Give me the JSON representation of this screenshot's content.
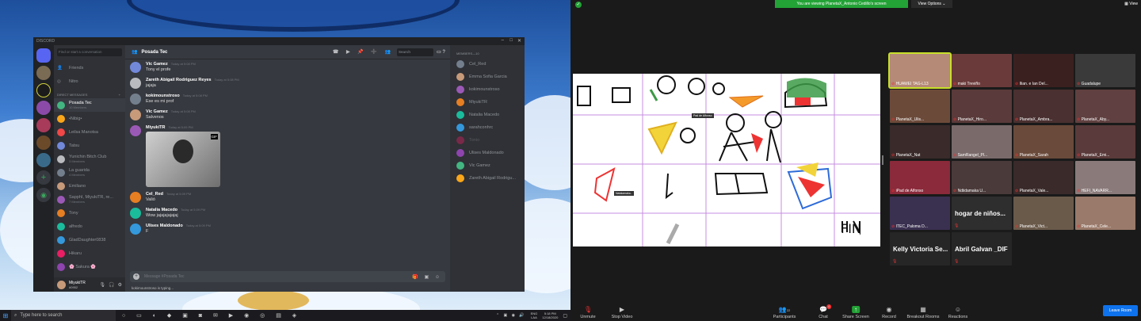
{
  "desktop": {
    "taskbar": {
      "search_placeholder": "Type here to search",
      "lang": "ENG",
      "lang2": "LAA",
      "time": "5:18 PM",
      "date": "12/18/2020"
    }
  },
  "discord": {
    "app_title": "DISCORD",
    "search_placeholder": "Find or start a conversation",
    "nav": {
      "friends": "Friends",
      "nitro": "Nitro",
      "dm_header": "DIRECT MESSAGES"
    },
    "dms": [
      {
        "name": "Posada Tec",
        "sub": "10 Members"
      },
      {
        "name": "•Nibig•",
        "sub": ""
      },
      {
        "name": "Leilsa Manotsa",
        "sub": ""
      },
      {
        "name": "Tatsu",
        "sub": ""
      },
      {
        "name": "Yunichin Bitch Club",
        "sub": "3 Members"
      },
      {
        "name": "La guarida",
        "sub": "4 Members"
      },
      {
        "name": "Emiliano",
        "sub": ""
      },
      {
        "name": "SapphI, MiyukiTR, re...",
        "sub": "7 Members"
      },
      {
        "name": "Tony",
        "sub": ""
      },
      {
        "name": "alfredo",
        "sub": ""
      },
      {
        "name": "GladDaughter0838",
        "sub": ""
      },
      {
        "name": "Hikaru",
        "sub": ""
      },
      {
        "name": "🌸 Sakura 🌸",
        "sub": ""
      }
    ],
    "user": {
      "name": "MiyukiTR",
      "tag": "#0952"
    },
    "chat_title": "Posada Tec",
    "chat_search": "Search",
    "messages": [
      {
        "name": "Vic Gamez",
        "time": "Today at 5:08 PM",
        "text": "Tony el profe"
      },
      {
        "name": "Zareth Abigail Rodriguez Reyes",
        "time": "Today at 5:08 PM",
        "text": "jajaja"
      },
      {
        "name": "kokimounstroso",
        "time": "Today at 5:08 PM",
        "text": "Ese es mi prof"
      },
      {
        "name": "Vic Gamez",
        "time": "Today at 5:08 PM",
        "text": "Salvenos"
      },
      {
        "name": "MiyukiTR",
        "time": "Today at 5:09 PM",
        "text": ""
      },
      {
        "name": "Cel_Red",
        "time": "Today at 5:09 PM",
        "text": "Valió"
      },
      {
        "name": "Natalia Macedo",
        "time": "Today at 5:09 PM",
        "text": "Wow jajajajajajaj"
      },
      {
        "name": "Ulises Maldonado",
        "time": "Today at 5:09 PM",
        "text": "F"
      }
    ],
    "gif_label": "GIF",
    "message_placeholder": "Message #Posada Tec",
    "typing": "kokimounstroso is typing...",
    "members_header": "MEMBERS—10",
    "members": [
      "Cel_Red",
      "Emma Sofia Garcia",
      "kokimounstroso",
      "MiyukiTR",
      "Natalia Macedo",
      "sarahconhrc",
      "Tonio",
      "Ulises Maldonado",
      "Vic Gamez",
      "Zareth Abigail Rodrigu..."
    ]
  },
  "zoom": {
    "banner": "You are viewing PlanetaX_Antonio Cedillo's screen",
    "view_options": "View Options ⌄",
    "view": "View",
    "board_labels": {
      "a": "Pad de Alfonso",
      "b": "Natalamaka..",
      "fin": "FIN"
    },
    "tiles": [
      {
        "name": "HUAWEI TAG-L13",
        "big": ""
      },
      {
        "name": "maki Treviño",
        "big": ""
      },
      {
        "name": "Ilian. e Ian Del...",
        "big": ""
      },
      {
        "name": "Guadalupe",
        "big": ""
      },
      {
        "name": "PlanetaX_Ulis...",
        "big": ""
      },
      {
        "name": "PlanetaX_Hiro...",
        "big": ""
      },
      {
        "name": "PlanetaX_Ambra...",
        "big": ""
      },
      {
        "name": "PlanetaX_Aby...",
        "big": ""
      },
      {
        "name": "PlanetaX_Nat",
        "big": ""
      },
      {
        "name": "SamRangel_Pl...",
        "big": ""
      },
      {
        "name": "PlanetaX_Sarah",
        "big": ""
      },
      {
        "name": "PlanetaX_Emi...",
        "big": ""
      },
      {
        "name": "iPad de Alfonso",
        "big": ""
      },
      {
        "name": "Ndiidamaka U...",
        "big": ""
      },
      {
        "name": "PlanetaX_Vale...",
        "big": ""
      },
      {
        "name": "HEFI_NAVARR...",
        "big": ""
      },
      {
        "name": "ITEC_Paloma D...",
        "big": ""
      },
      {
        "name": "",
        "big": "hogar de niños..."
      },
      {
        "name": "PlanetaX_Vict...",
        "big": ""
      },
      {
        "name": "PlanetaX_Cele...",
        "big": ""
      },
      {
        "name": "",
        "big": "Kelly Victoria Se..."
      },
      {
        "name": "",
        "big": "Abril Galvan _DIF"
      }
    ],
    "toolbar": {
      "mute": "Unmute",
      "video": "Stop Video",
      "participants": "Participants",
      "participants_count": "22",
      "chat": "Chat",
      "chat_badge": "4",
      "share": "Share Screen",
      "record": "Record",
      "breakout": "Breakout Rooms",
      "reactions": "Reactions",
      "leave": "Leave Room"
    }
  }
}
